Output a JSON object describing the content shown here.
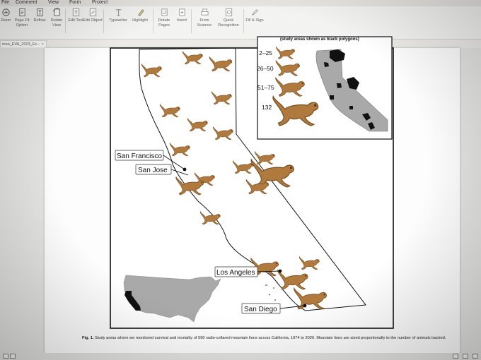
{
  "menu": {
    "file": "File",
    "comment": "Comment",
    "view": "View",
    "form": "Form",
    "protect": "Protect"
  },
  "ribbon": {
    "zoom": "Zoom",
    "page_fit": "Page Fit Option",
    "reflow": "Reflow",
    "rotate_view": "Rotate View",
    "edit_text": "Edit Text",
    "edit_object": "Edit Object",
    "typewriter": "Typewriter",
    "highlight": "Highlight",
    "rotate_pages": "Rotate Pages",
    "insert": "Insert",
    "from_scanner": "From Scanner",
    "quick_recognition": "Quick Recognition",
    "fill_sign": "Fill & Sign"
  },
  "tab": {
    "label": "mon_EVA_2023_Ec...",
    "close": "×"
  },
  "map": {
    "legend_title": "(study areas shown as black polygons)",
    "legend_items": [
      "2–25",
      "26–50",
      "51–75",
      "132"
    ],
    "cities": {
      "sf": "San Francisco",
      "sj": "San Jose",
      "la": "Los Angeles",
      "sd": "San Diego"
    }
  },
  "figure": {
    "label": "Fig. 1.",
    "caption": "Study areas where we monitored survival and mortality of 590 radio-collared mountain lions across California, 1974 to 2020. Mountain lions are sized proportionally to the number of animals tracked."
  },
  "colors": {
    "lion": "#b07a3e",
    "lion_dark": "#7a4f24",
    "study_area": "#111111",
    "inset_state": "#a9a9a9"
  }
}
